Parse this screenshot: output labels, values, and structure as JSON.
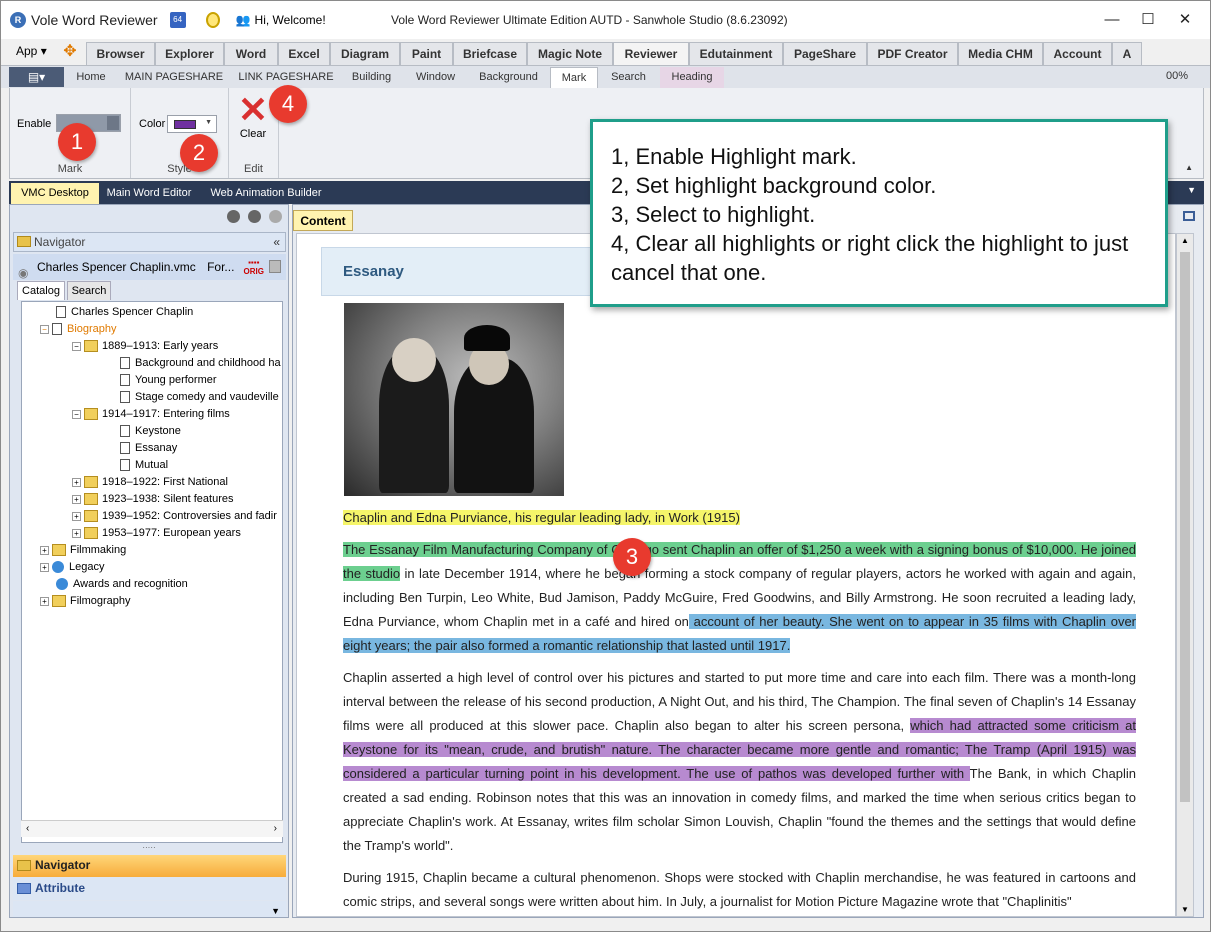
{
  "app": {
    "name": "Vole Word Reviewer",
    "qa_badge": "64",
    "welcome": "Hi, Welcome!",
    "window_title": "Vole Word Reviewer Ultimate Edition AUTD - Sanwhole Studio (8.6.23092)",
    "controls": {
      "minimize": "—",
      "maximize": "☐",
      "close": "✕"
    }
  },
  "menu": {
    "app_label": "App",
    "tabs": [
      "Browser",
      "Explorer",
      "Word",
      "Excel",
      "Diagram",
      "Paint",
      "Briefcase",
      "Magic Note",
      "Reviewer",
      "Edutainment",
      "PageShare",
      "PDF Creator",
      "Media CHM",
      "Account",
      "A"
    ],
    "active_tab": "Reviewer"
  },
  "subtabs": {
    "items": [
      "Home",
      "MAIN PAGESHARE",
      "LINK PAGESHARE",
      "Building",
      "Window",
      "Background",
      "Mark",
      "Search",
      "Heading"
    ],
    "active": "Mark",
    "zoom": "00%"
  },
  "ribbon": {
    "mark_group": {
      "enable_label": "Enable",
      "group_label": "Mark"
    },
    "style_group": {
      "color_label": "Color",
      "group_label": "Style",
      "color_value": "#7030a0"
    },
    "edit_group": {
      "clear_label": "Clear",
      "group_label": "Edit"
    }
  },
  "badges": [
    "1",
    "2",
    "3",
    "4"
  ],
  "callout": {
    "lines": [
      "1, Enable Highlight mark.",
      "2, Set highlight background color.",
      "3, Select to highlight.",
      "4, Clear all highlights or right click the highlight to just cancel that one."
    ]
  },
  "dock_tabs": {
    "items": [
      "VMC Desktop",
      "Main Word Editor",
      "Web Animation Builder"
    ],
    "active": "VMC Desktop"
  },
  "navigator": {
    "title": "Navigator",
    "file": "Charles Spencer Chaplin.vmc",
    "file_suffix": "For...",
    "orig_badge": "ORIG",
    "catalog_tab": "Catalog",
    "search_tab": "Search",
    "tree": [
      "Charles Spencer Chaplin",
      "Biography",
      "1889–1913: Early years",
      "Background and childhood ha",
      "Young performer",
      "Stage comedy and vaudeville",
      "1914–1917: Entering films",
      "Keystone",
      "Essanay",
      "Mutual",
      "1918–1922: First National",
      "1923–1938: Silent features",
      "1939–1952: Controversies and fadir",
      "1953–1977: European years",
      "Filmmaking",
      "Legacy",
      "Awards and recognition",
      "Filmography"
    ],
    "bottom_nav": "Navigator",
    "bottom_attr": "Attribute"
  },
  "content": {
    "tab_label": "Content",
    "section_title": "Essanay",
    "caption": "Chaplin and Edna Purviance, his regular leading lady, in Work (1915)",
    "p1_green": "The Essanay Film Manufacturing Company of Chicago sent Chaplin an offer of $1,250 a week with a signing bonus of $10,000. He joined the studio",
    "p1_mid": " in late December 1914, where he began forming a stock company of regular players, actors he worked with again and again, including Ben Turpin, Leo White, Bud Jamison, Paddy McGuire, Fred Goodwins, and Billy Armstrong. He soon recruited a leading lady, Edna Purviance, whom Chaplin met in a café and hired on",
    "p1_blue": " account of her beauty. She went on to appear in 35 films with Chaplin over eight years; the pair also formed a romantic relationship that lasted until 1917.",
    "p2_pre": "Chaplin asserted a high level of control over his pictures and started to put more time and care into each film. There was a month-long interval between the release of his second production, A Night Out, and his third, The Champion. The final seven of Chaplin's 14 Essanay films were all produced at this slower pace. Chaplin also began to alter his screen persona, ",
    "p2_purple": "which had attracted some criticism at Keystone for its \"mean, crude, and brutish\" nature. The character became more gentle and romantic; The Tramp (April 1915) was considered a particular turning point in his development. The use of pathos was developed further with ",
    "p2_post": "The Bank, in which Chaplin created a sad ending. Robinson notes that this was an innovation in comedy films, and marked the time when serious critics began to appreciate Chaplin's work. At Essanay, writes film scholar Simon Louvish, Chaplin \"found the themes and the settings that would define the Tramp's world\".",
    "p3": "During 1915, Chaplin became a cultural phenomenon. Shops were stocked with Chaplin merchandise, he was featured in cartoons and comic strips, and several songs were written about him. In July, a journalist for Motion Picture Magazine wrote that \"Chaplinitis\""
  }
}
